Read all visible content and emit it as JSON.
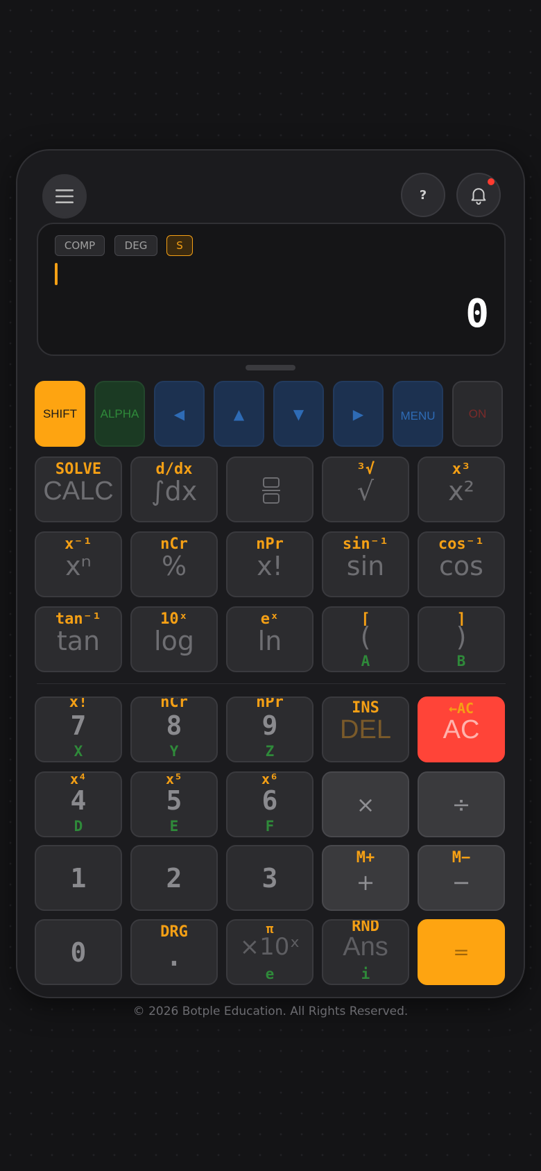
{
  "indicators": {
    "mode": "COMP",
    "angle": "DEG",
    "shift": "S"
  },
  "display": {
    "result": "0"
  },
  "top": {
    "help_label": "?"
  },
  "row1": {
    "shift": "SHIFT",
    "alpha": "ALPHA",
    "left": "◀",
    "up": "▲",
    "down": "▼",
    "right": "▶",
    "menu": "MENU",
    "on": "ON"
  },
  "sci": {
    "calc": {
      "sub": "SOLVE",
      "main": "CALC"
    },
    "integral": {
      "sub": "d/dx",
      "main": "∫dx"
    },
    "cuberoot": {
      "sub": "³√",
      "main": "√"
    },
    "square": {
      "sub": "x³",
      "main": "x²"
    },
    "xpow": {
      "sub": "x⁻¹",
      "main": "xⁿ"
    },
    "percent": {
      "sub": "nCr",
      "main": "%"
    },
    "fact": {
      "sub": "nPr",
      "main": "x!"
    },
    "sin": {
      "sub": "sin⁻¹",
      "main": "sin"
    },
    "cos": {
      "sub": "cos⁻¹",
      "main": "cos"
    },
    "tan": {
      "sub": "tan⁻¹",
      "main": "tan"
    },
    "log": {
      "sub": "10ˣ",
      "main": "log"
    },
    "ln": {
      "sub": "eˣ",
      "main": "ln"
    },
    "lparen": {
      "sub": "⌈",
      "main": "(",
      "alpha": "A"
    },
    "rparen": {
      "sub": "⌉",
      "main": ")",
      "alpha": "B"
    }
  },
  "keys": {
    "k7": {
      "sub": "x!",
      "main": "7",
      "alpha": "X"
    },
    "k8": {
      "sub": "nCr",
      "main": "8",
      "alpha": "Y"
    },
    "k9": {
      "sub": "nPr",
      "main": "9",
      "alpha": "Z"
    },
    "del": {
      "sub": "INS",
      "main": "DEL"
    },
    "ac": {
      "sub": "←AC",
      "main": "AC"
    },
    "k4": {
      "sub": "x⁴",
      "main": "4",
      "alpha": "D"
    },
    "k5": {
      "sub": "x⁵",
      "main": "5",
      "alpha": "E"
    },
    "k6": {
      "sub": "x⁶",
      "main": "6",
      "alpha": "F"
    },
    "mul": {
      "main": "×"
    },
    "div": {
      "main": "÷"
    },
    "k1": {
      "main": "1"
    },
    "k2": {
      "main": "2"
    },
    "k3": {
      "main": "3"
    },
    "plus": {
      "sub": "M+",
      "main": "+"
    },
    "minus": {
      "sub": "M−",
      "main": "−"
    },
    "k0": {
      "main": "0"
    },
    "dot": {
      "sub": "DRG",
      "main": "."
    },
    "exp": {
      "sub": "π",
      "main": "×10ˣ",
      "alpha": "e"
    },
    "ans": {
      "sub": "RND",
      "main": "Ans",
      "alpha": "i"
    },
    "equals": {
      "main": "="
    }
  },
  "footer": "© 2026 Botple Education. All Rights Reserved.",
  "colors": {
    "accent": "#f5a015",
    "ac": "#ff4438",
    "alpha": "#2f8a3a",
    "nav": "#1c3150"
  }
}
